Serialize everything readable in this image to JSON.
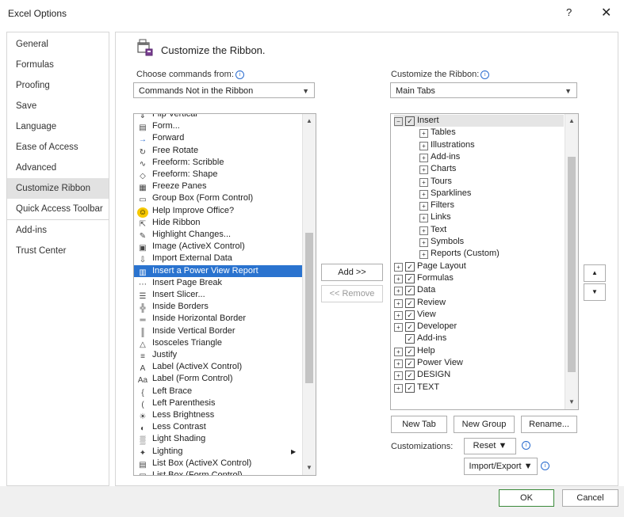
{
  "window": {
    "title": "Excel Options",
    "help": "?",
    "close": "✕"
  },
  "sidebar": {
    "items": [
      {
        "label": "General"
      },
      {
        "label": "Formulas"
      },
      {
        "label": "Proofing"
      },
      {
        "label": "Save"
      },
      {
        "label": "Language"
      },
      {
        "label": "Ease of Access"
      },
      {
        "label": "Advanced"
      },
      {
        "label": "Customize Ribbon"
      },
      {
        "label": "Quick Access Toolbar"
      },
      {
        "label": "Add-ins"
      },
      {
        "label": "Trust Center"
      }
    ],
    "selected": "Customize Ribbon"
  },
  "header": {
    "title": "Customize the Ribbon."
  },
  "left": {
    "choose_label": "Choose commands from:",
    "choose_value": "Commands Not in the Ribbon",
    "commands": [
      {
        "label": "Flip Vertical",
        "icon": "flip-vertical-icon"
      },
      {
        "label": "Form...",
        "icon": "form-icon"
      },
      {
        "label": "Forward",
        "icon": "forward-arrow-icon"
      },
      {
        "label": "Free Rotate",
        "icon": "rotate-icon"
      },
      {
        "label": "Freeform: Scribble",
        "icon": "scribble-icon"
      },
      {
        "label": "Freeform: Shape",
        "icon": "freeform-shape-icon"
      },
      {
        "label": "Freeze Panes",
        "icon": "freeze-panes-icon"
      },
      {
        "label": "Group Box (Form Control)",
        "icon": "group-box-icon"
      },
      {
        "label": "Help Improve Office?",
        "icon": "smiley-icon"
      },
      {
        "label": "Hide Ribbon",
        "icon": "hide-ribbon-icon"
      },
      {
        "label": "Highlight Changes...",
        "icon": "highlight-changes-icon"
      },
      {
        "label": "Image (ActiveX Control)",
        "icon": "image-control-icon"
      },
      {
        "label": "Import External Data",
        "icon": "import-data-icon"
      },
      {
        "label": "Insert a Power View Report",
        "icon": "power-view-icon"
      },
      {
        "label": "Insert Page Break",
        "icon": "page-break-icon"
      },
      {
        "label": "Insert Slicer...",
        "icon": "slicer-icon"
      },
      {
        "label": "Inside Borders",
        "icon": "inside-borders-icon"
      },
      {
        "label": "Inside Horizontal Border",
        "icon": "horizontal-border-icon"
      },
      {
        "label": "Inside Vertical Border",
        "icon": "vertical-border-icon"
      },
      {
        "label": "Isosceles Triangle",
        "icon": "triangle-icon"
      },
      {
        "label": "Justify",
        "icon": "justify-icon"
      },
      {
        "label": "Label (ActiveX Control)",
        "icon": "label-activex-icon"
      },
      {
        "label": "Label (Form Control)",
        "icon": "label-form-icon"
      },
      {
        "label": "Left Brace",
        "icon": "left-brace-icon"
      },
      {
        "label": "Left Parenthesis",
        "icon": "left-parenthesis-icon"
      },
      {
        "label": "Less Brightness",
        "icon": "brightness-icon"
      },
      {
        "label": "Less Contrast",
        "icon": "contrast-icon"
      },
      {
        "label": "Light Shading",
        "icon": "shading-icon"
      },
      {
        "label": "Lighting",
        "icon": "lighting-icon"
      },
      {
        "label": "List Box (ActiveX Control)",
        "icon": "list-box-icon"
      },
      {
        "label": "List Box (Form Control)",
        "icon": "list-box-form-icon"
      }
    ],
    "selected": "Insert a Power View Report"
  },
  "middle": {
    "add_label": "Add >>",
    "remove_label": "<< Remove"
  },
  "right": {
    "customize_label": "Customize the Ribbon:",
    "customize_value": "Main Tabs",
    "tree": [
      {
        "label": "Insert",
        "level": 0,
        "expander": "⊟",
        "checked": true
      },
      {
        "label": "Tables",
        "level": 1,
        "expander": "⊞"
      },
      {
        "label": "Illustrations",
        "level": 1,
        "expander": "⊞"
      },
      {
        "label": "Add-ins",
        "level": 1,
        "expander": "⊞"
      },
      {
        "label": "Charts",
        "level": 1,
        "expander": "⊞"
      },
      {
        "label": "Tours",
        "level": 1,
        "expander": "⊞"
      },
      {
        "label": "Sparklines",
        "level": 1,
        "expander": "⊞"
      },
      {
        "label": "Filters",
        "level": 1,
        "expander": "⊞"
      },
      {
        "label": "Links",
        "level": 1,
        "expander": "⊞"
      },
      {
        "label": "Text",
        "level": 1,
        "expander": "⊞"
      },
      {
        "label": "Symbols",
        "level": 1,
        "expander": "⊞"
      },
      {
        "label": "Reports (Custom)",
        "level": 1,
        "expander": "⊞"
      },
      {
        "label": "Page Layout",
        "level": 0,
        "expander": "⊞",
        "checked": true
      },
      {
        "label": "Formulas",
        "level": 0,
        "expander": "⊞",
        "checked": true
      },
      {
        "label": "Data",
        "level": 0,
        "expander": "⊞",
        "checked": true
      },
      {
        "label": "Review",
        "level": 0,
        "expander": "⊞",
        "checked": true
      },
      {
        "label": "View",
        "level": 0,
        "expander": "⊞",
        "checked": true
      },
      {
        "label": "Developer",
        "level": 0,
        "expander": "⊞",
        "checked": true
      },
      {
        "label": "Add-ins",
        "level": 0,
        "expander": "",
        "checked": true
      },
      {
        "label": "Help",
        "level": 0,
        "expander": "⊞",
        "checked": true
      },
      {
        "label": "Power View",
        "level": 0,
        "expander": "⊞",
        "checked": true
      },
      {
        "label": "DESIGN",
        "level": 0,
        "expander": "⊞",
        "checked": true
      },
      {
        "label": "TEXT",
        "level": 0,
        "expander": "⊞",
        "checked": true
      }
    ],
    "new_tab": "New Tab",
    "new_group": "New Group",
    "rename": "Rename...",
    "customizations_label": "Customizations:",
    "reset_label": "Reset ▼",
    "import_export_label": "Import/Export ▼"
  },
  "footer": {
    "ok": "OK",
    "cancel": "Cancel"
  }
}
